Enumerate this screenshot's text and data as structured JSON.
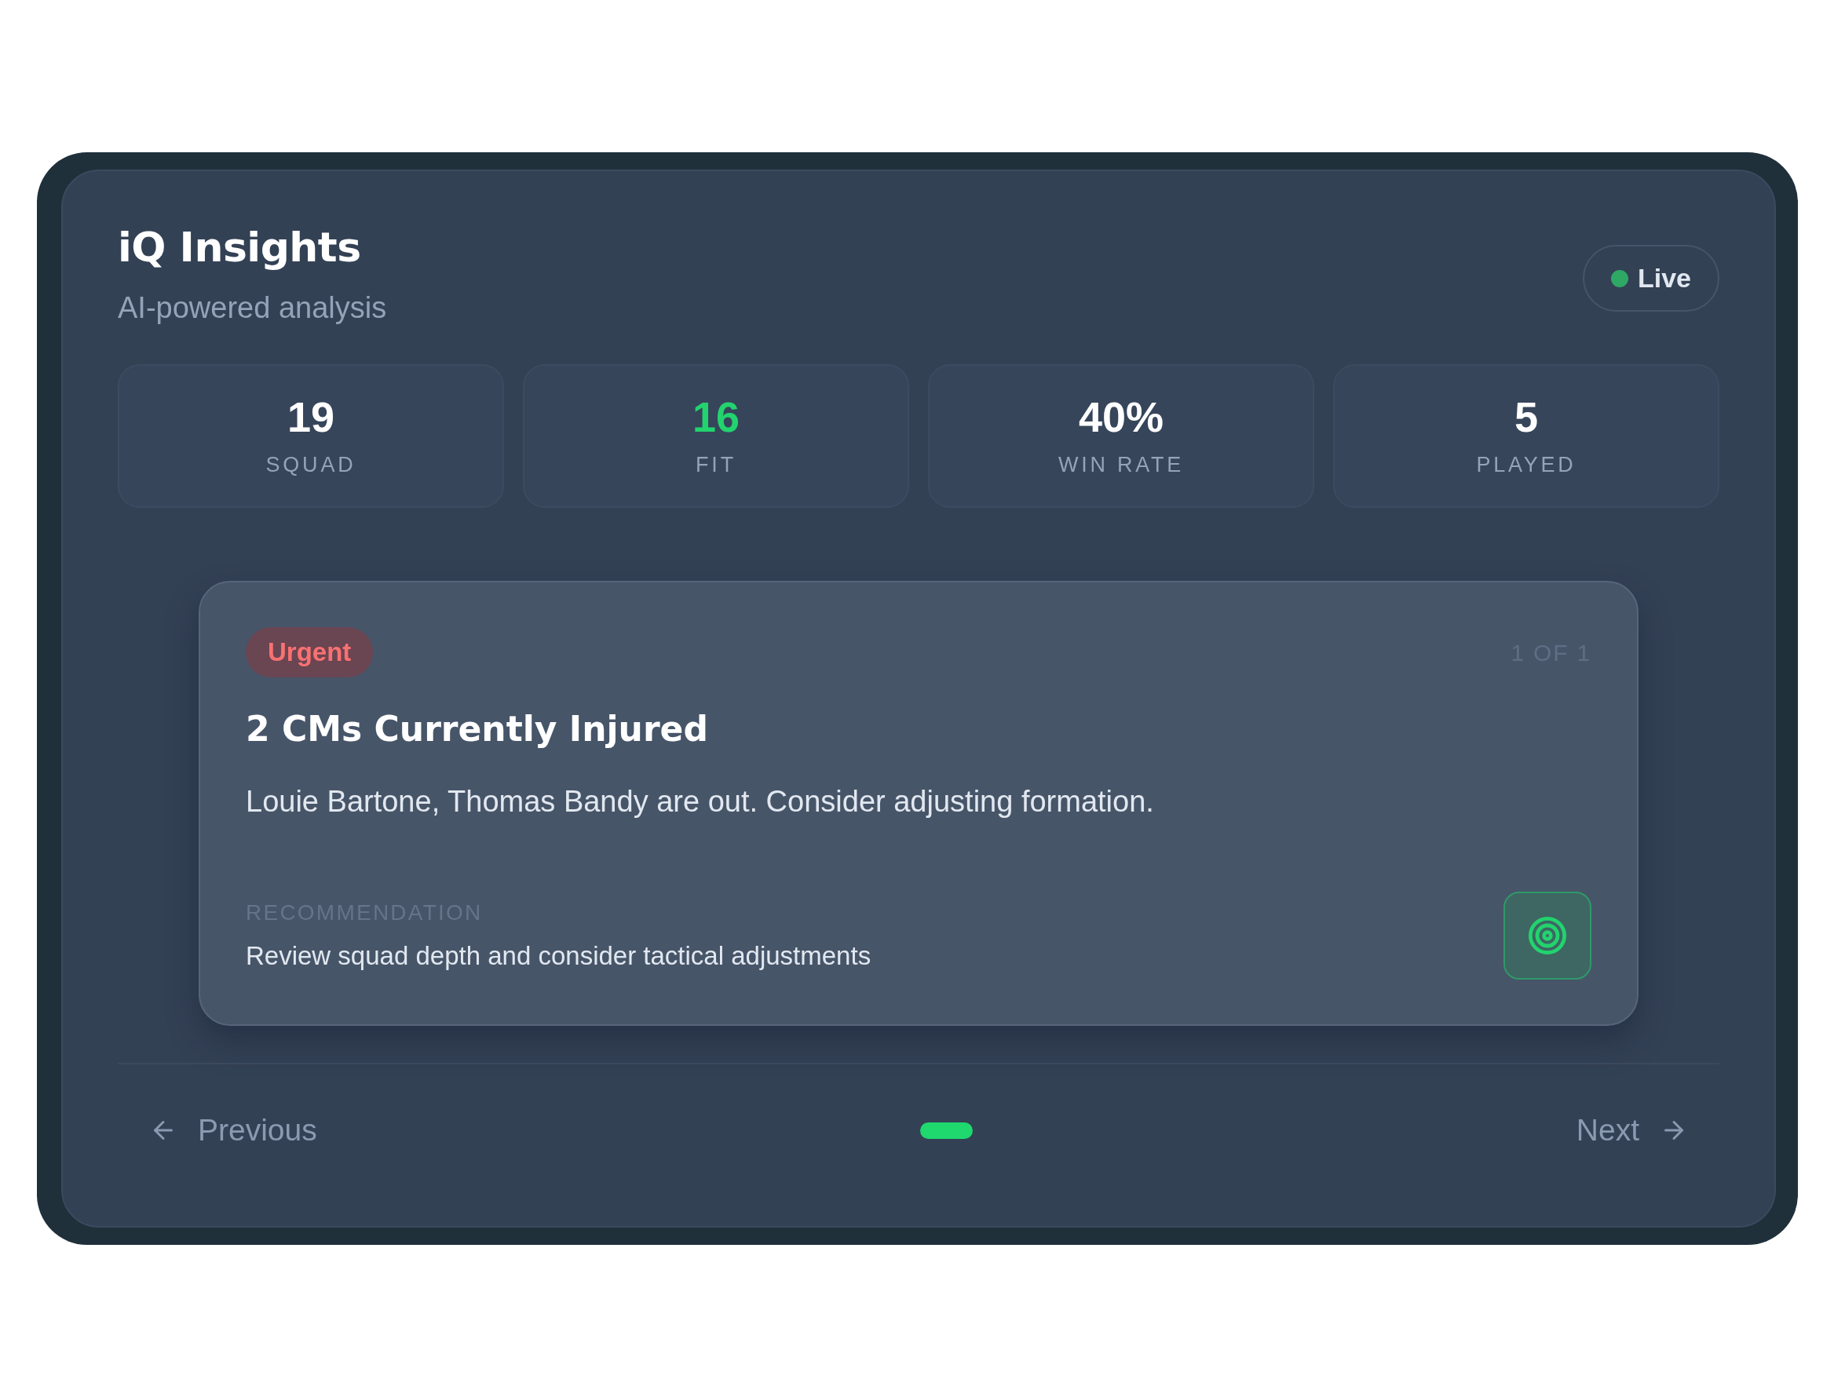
{
  "header": {
    "title": "iQ Insights",
    "subtitle": "AI-powered analysis",
    "status": {
      "label": "Live",
      "active": true
    }
  },
  "stats": [
    {
      "value": "19",
      "label": "SQUAD",
      "highlight": false
    },
    {
      "value": "16",
      "label": "FIT",
      "highlight": true
    },
    {
      "value": "40%",
      "label": "WIN RATE",
      "highlight": false
    },
    {
      "value": "5",
      "label": "PLAYED",
      "highlight": false
    }
  ],
  "insight": {
    "priority": {
      "label": "Urgent",
      "kind": "urgent"
    },
    "position": "1 OF 1",
    "title": "2 CMs Currently Injured",
    "body": "Louie Bartone, Thomas Bandy are out. Consider adjusting formation.",
    "recommendation_label": "RECOMMENDATION",
    "recommendation": "Review squad depth and consider tactical adjustments"
  },
  "pagination": {
    "previous": "Previous",
    "next": "Next",
    "dots": [
      {
        "selected": true
      }
    ]
  }
}
